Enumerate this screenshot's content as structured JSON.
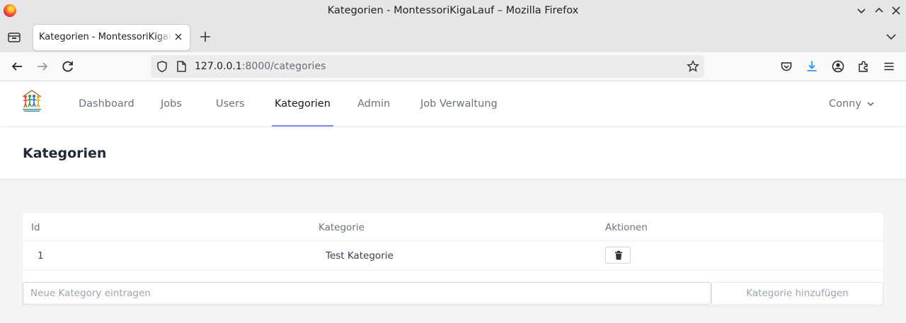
{
  "window": {
    "title": "Kategorien - MontessoriKigaLauf – Mozilla Firefox"
  },
  "browser": {
    "tab_title": "Kategorien - MontessoriKigaLauf",
    "url_host": "127.0.0.1",
    "url_path": ":8000/categories"
  },
  "nav": {
    "items": [
      {
        "label": "Dashboard"
      },
      {
        "label": "Jobs"
      },
      {
        "label": "Users"
      },
      {
        "label": "Kategorien"
      },
      {
        "label": "Admin"
      },
      {
        "label": "Job Verwaltung"
      }
    ],
    "active": "Kategorien",
    "user": "Conny"
  },
  "page": {
    "title": "Kategorien"
  },
  "table": {
    "headers": [
      "Id",
      "Kategorie",
      "Aktionen"
    ],
    "rows": [
      {
        "id": "1",
        "category": "Test Kategorie"
      }
    ]
  },
  "form": {
    "placeholder": "Neue Kategory eintragen",
    "value": "",
    "button_label": "Kategorie hinzufügen"
  },
  "colors": {
    "active_underline": "#818cf8",
    "page_bg": "#f3f4f6"
  }
}
